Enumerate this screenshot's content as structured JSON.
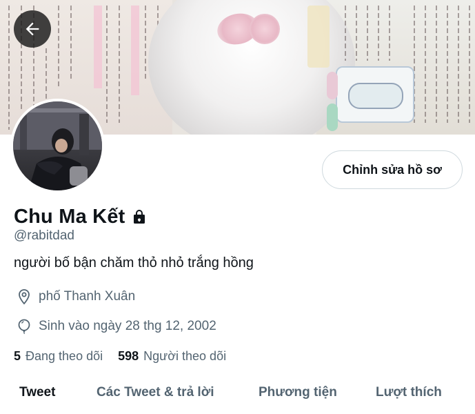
{
  "header": {
    "back_icon": "arrow-left-icon",
    "banner_description_icon": "banner-image",
    "edit_profile_label": "Chỉnh sửa hồ sơ"
  },
  "profile": {
    "display_name": "Chu Ma Kết",
    "protected_icon": "lock-icon",
    "handle": "@rabitdad",
    "bio": "người bố bận chăm thỏ nhỏ trắng hồng",
    "location": "phố Thanh Xuân",
    "location_icon": "map-pin-icon",
    "birthday": "Sinh vào ngày 28 thg 12, 2002",
    "birthday_icon": "balloon-icon"
  },
  "stats": {
    "following_count": "5",
    "following_label": "Đang theo dõi",
    "followers_count": "598",
    "followers_label": "Người theo dõi"
  },
  "tabs": [
    {
      "label": "Tweet",
      "active": true
    },
    {
      "label": "Các Tweet & trả lời",
      "active": false
    },
    {
      "label": "Phương tiện",
      "active": false
    },
    {
      "label": "Lượt thích",
      "active": false
    }
  ],
  "colors": {
    "primary_text": "#0f1419",
    "secondary_text": "#536471",
    "border": "#cfd9de",
    "back_button_bg": "#181818"
  }
}
